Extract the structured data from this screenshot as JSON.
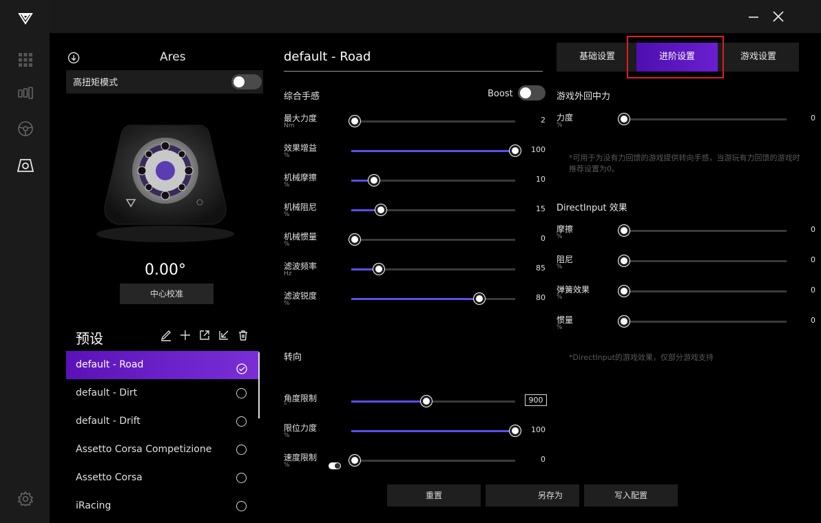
{
  "window": {
    "minimize_icon": "minimize-icon",
    "close_icon": "close-icon"
  },
  "sidebar": {
    "icons": [
      "logo-icon",
      "grid-icon",
      "pedals-icon",
      "steering-wheel-icon",
      "wheelbase-icon",
      "settings-icon"
    ]
  },
  "device": {
    "name": "Ares",
    "high_torque_label": "高扭矩模式",
    "angle": "0.00°",
    "center_button": "中心校准"
  },
  "presets": {
    "title": "预设",
    "items": [
      {
        "label": "default - Road",
        "active": true
      },
      {
        "label": "default - Dirt",
        "active": false
      },
      {
        "label": "default - Drift",
        "active": false
      },
      {
        "label": "Assetto Corsa Competizione",
        "active": false
      },
      {
        "label": "Assetto Corsa",
        "active": false
      },
      {
        "label": "iRacing",
        "active": false
      }
    ]
  },
  "main": {
    "profile_name": "default - Road",
    "section_general": "综合手感",
    "boost_label": "Boost",
    "sliders": [
      {
        "label": "最大力度",
        "unit": "Nm",
        "value": "2",
        "level": 0.02
      },
      {
        "label": "效果增益",
        "unit": "%",
        "value": "100",
        "level": 1.0
      },
      {
        "label": "机械摩擦",
        "unit": "%",
        "value": "10",
        "level": 0.14
      },
      {
        "label": "机械阻尼",
        "unit": "%",
        "value": "15",
        "level": 0.18
      },
      {
        "label": "机械惯量",
        "unit": "%",
        "value": "0",
        "level": 0.02
      },
      {
        "label": "滤波频率",
        "unit": "Hz",
        "value": "85",
        "level": 0.17
      },
      {
        "label": "滤波锐度",
        "unit": "%",
        "value": "80",
        "level": 0.78
      }
    ],
    "section_steering": "转向",
    "steering": [
      {
        "label": "角度限制",
        "unit": "°",
        "value": "900",
        "level": 0.46
      },
      {
        "label": "限位力度",
        "unit": "%",
        "value": "100",
        "level": 1.0
      },
      {
        "label": "速度限制",
        "unit": "%",
        "value": "0",
        "level": 0.02
      }
    ],
    "buttons": {
      "reset": "重置",
      "save_as": "另存为",
      "write": "写入配置"
    }
  },
  "tabs": [
    "基础设置",
    "进阶设置",
    "游戏设置"
  ],
  "right": {
    "section_center": "游戏外回中力",
    "force": {
      "label": "力度",
      "unit": "%",
      "value": "0"
    },
    "note1": "*可用于为没有力回馈的游戏提供转向手感，当游玩有力回馈的游戏时推荐设置为0。",
    "section_di": "DirectInput 效果",
    "di": [
      {
        "label": "摩擦",
        "unit": "%",
        "value": "0"
      },
      {
        "label": "阻尼",
        "unit": "%",
        "value": "0"
      },
      {
        "label": "弹簧效果",
        "unit": "%",
        "value": "0"
      },
      {
        "label": "惯量",
        "unit": "%",
        "value": "0"
      }
    ],
    "note2": "*DirectInput的游戏效果，仅部分游戏支持"
  },
  "colors": {
    "accent": "#5b4ff0",
    "active_tab": "#6a1fd0",
    "highlight": "#e0201e"
  }
}
